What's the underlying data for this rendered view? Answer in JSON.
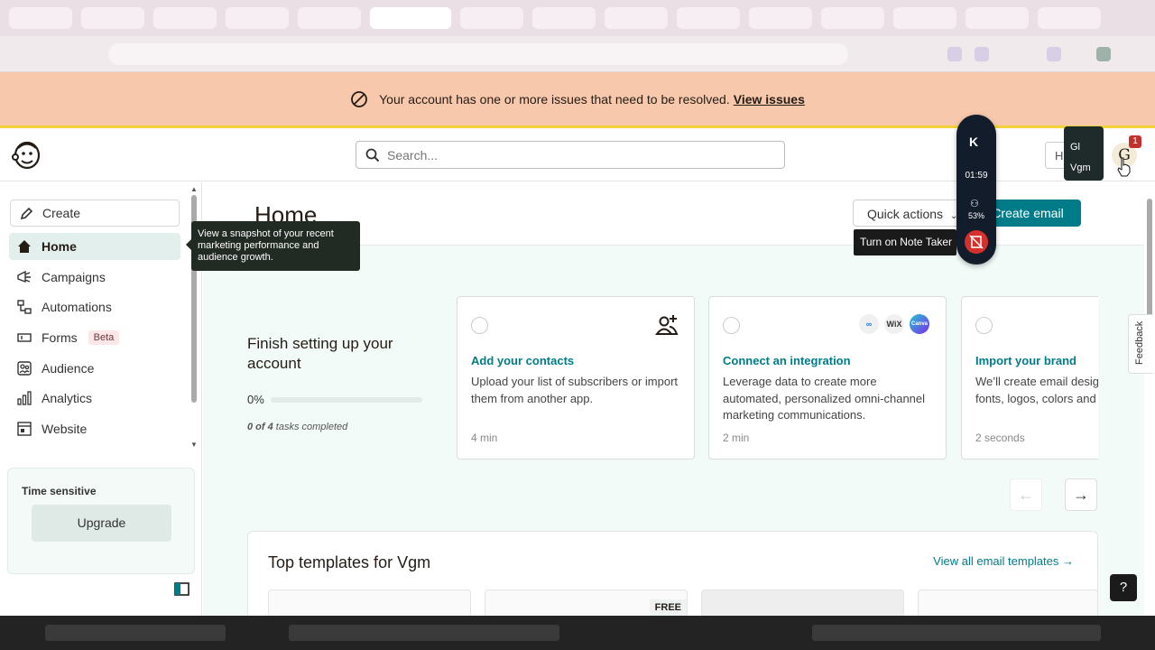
{
  "alert": {
    "message": "Your account has one or more issues that need to be resolved.",
    "link": "View issues",
    "color": "#f7c8ac"
  },
  "header": {
    "search_placeholder": "Search...",
    "help_initial": "H",
    "account_popover": [
      "Gl",
      "Vgm"
    ],
    "avatar_initial": "G",
    "notification_count": "1"
  },
  "sidebar": {
    "create_label": "Create",
    "items": [
      {
        "label": "Home",
        "icon": "home-icon",
        "active": true
      },
      {
        "label": "Campaigns",
        "icon": "megaphone-icon"
      },
      {
        "label": "Automations",
        "icon": "automation-icon"
      },
      {
        "label": "Forms",
        "icon": "forms-icon",
        "badge": "Beta"
      },
      {
        "label": "Audience",
        "icon": "audience-icon"
      },
      {
        "label": "Analytics",
        "icon": "analytics-icon"
      },
      {
        "label": "Website",
        "icon": "website-icon"
      }
    ],
    "time_sensitive_label": "Time sensitive",
    "upgrade_label": "Upgrade",
    "home_tooltip": "View a snapshot of your recent marketing performance and audience growth."
  },
  "main": {
    "title": "Home",
    "quick_actions": "Quick actions",
    "create_email": "Create email",
    "brand_color": "#007c89",
    "setup": {
      "title": "Finish setting up your account",
      "progress_label": "0%",
      "progress_fraction": 0,
      "tasks_count": "0 of 4",
      "tasks_suffix": "tasks completed"
    },
    "cards": [
      {
        "title": "Add your contacts",
        "description": "Upload your list of subscribers or import them from another app.",
        "time": "4 min",
        "icon": "add-contact-icon"
      },
      {
        "title": "Connect an integration",
        "description": "Leverage data to create more automated, personalized omni-channel marketing communications.",
        "time": "2 min",
        "icon": "integration-logos-icon",
        "logos": [
          "meta",
          "WiX",
          "Canva"
        ]
      },
      {
        "title": "Import your brand",
        "description": "We’ll create email designs with your fonts, logos, colors and",
        "time": "2 seconds",
        "icon": "brand-icon"
      }
    ],
    "templates": {
      "title": "Top templates for Vgm",
      "link": "View all email templates →",
      "free_badge": "FREE"
    },
    "feedback_label": "Feedback",
    "help_label": "?"
  },
  "notetaker": {
    "logo": "K",
    "timer": "01:59",
    "percent": "53%",
    "tooltip": "Turn on Note Taker"
  }
}
